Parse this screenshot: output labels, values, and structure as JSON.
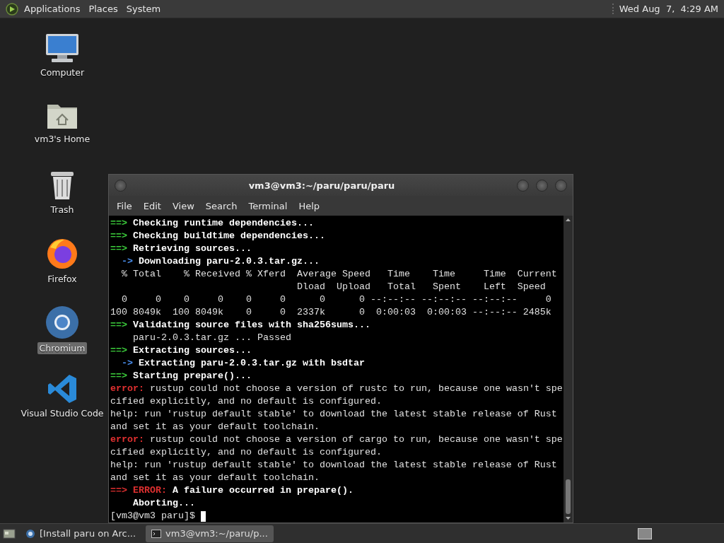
{
  "top_panel": {
    "menus": [
      "Applications",
      "Places",
      "System"
    ],
    "clock": "Wed Aug  7,  4:29 AM"
  },
  "desktop_icons": [
    {
      "kind": "computer",
      "label": "Computer",
      "selected": false
    },
    {
      "kind": "home",
      "label": "vm3's Home",
      "selected": false
    },
    {
      "kind": "trash",
      "label": "Trash",
      "selected": false
    },
    {
      "kind": "firefox",
      "label": "Firefox",
      "selected": false
    },
    {
      "kind": "chromium",
      "label": "Chromium",
      "selected": true
    },
    {
      "kind": "vscode",
      "label": "Visual Studio Code",
      "selected": false
    }
  ],
  "terminal": {
    "title": "vm3@vm3:~/paru/paru/paru",
    "menu": [
      "File",
      "Edit",
      "View",
      "Search",
      "Terminal",
      "Help"
    ],
    "lines": [
      [
        {
          "kind": "arrow",
          "text": "==> "
        },
        {
          "kind": "bold",
          "text": "Checking runtime dependencies..."
        }
      ],
      [
        {
          "kind": "arrow",
          "text": "==> "
        },
        {
          "kind": "bold",
          "text": "Checking buildtime dependencies..."
        }
      ],
      [
        {
          "kind": "arrow",
          "text": "==> "
        },
        {
          "kind": "bold",
          "text": "Retrieving sources..."
        }
      ],
      [
        {
          "kind": "subarrow",
          "text": "  -> "
        },
        {
          "kind": "bold",
          "text": "Downloading paru-2.0.3.tar.gz..."
        }
      ],
      [
        {
          "kind": "plain",
          "text": "  % Total    % Received % Xferd  Average Speed   Time    Time     Time  Current"
        }
      ],
      [
        {
          "kind": "plain",
          "text": "                                 Dload  Upload   Total   Spent    Left  Speed"
        }
      ],
      [
        {
          "kind": "plain",
          "text": "  0     0    0     0    0     0      0      0 --:--:-- --:--:-- --:--:--     0"
        }
      ],
      [
        {
          "kind": "plain",
          "text": "100 8049k  100 8049k    0     0  2337k      0  0:00:03  0:00:03 --:--:-- 2485k"
        }
      ],
      [
        {
          "kind": "arrow",
          "text": "==> "
        },
        {
          "kind": "bold",
          "text": "Validating source files with sha256sums..."
        }
      ],
      [
        {
          "kind": "plain",
          "text": "    paru-2.0.3.tar.gz ... Passed"
        }
      ],
      [
        {
          "kind": "arrow",
          "text": "==> "
        },
        {
          "kind": "bold",
          "text": "Extracting sources..."
        }
      ],
      [
        {
          "kind": "subarrow",
          "text": "  -> "
        },
        {
          "kind": "bold",
          "text": "Extracting paru-2.0.3.tar.gz with bsdtar"
        }
      ],
      [
        {
          "kind": "arrow",
          "text": "==> "
        },
        {
          "kind": "bold",
          "text": "Starting prepare()..."
        }
      ],
      [
        {
          "kind": "error",
          "text": "error:"
        },
        {
          "kind": "plain",
          "text": " rustup could not choose a version of rustc to run, because one wasn't spe"
        }
      ],
      [
        {
          "kind": "plain",
          "text": "cified explicitly, and no default is configured."
        }
      ],
      [
        {
          "kind": "plain",
          "text": "help: run 'rustup default stable' to download the latest stable release of Rust"
        }
      ],
      [
        {
          "kind": "plain",
          "text": "and set it as your default toolchain."
        }
      ],
      [
        {
          "kind": "error",
          "text": "error:"
        },
        {
          "kind": "plain",
          "text": " rustup could not choose a version of cargo to run, because one wasn't spe"
        }
      ],
      [
        {
          "kind": "plain",
          "text": "cified explicitly, and no default is configured."
        }
      ],
      [
        {
          "kind": "plain",
          "text": "help: run 'rustup default stable' to download the latest stable release of Rust"
        }
      ],
      [
        {
          "kind": "plain",
          "text": "and set it as your default toolchain."
        }
      ],
      [
        {
          "kind": "error",
          "text": "==> ERROR:"
        },
        {
          "kind": "bold",
          "text": " A failure occurred in prepare()."
        }
      ],
      [
        {
          "kind": "bold",
          "text": "    Aborting..."
        }
      ],
      [
        {
          "kind": "plain",
          "text": "[vm3@vm3 paru]$ "
        }
      ]
    ],
    "cursor": true
  },
  "taskbar": {
    "tasks": [
      {
        "kind": "browser",
        "label": "[Install paru on Arc...",
        "selected": false
      },
      {
        "kind": "terminal",
        "label": "vm3@vm3:~/paru/p...",
        "selected": true
      }
    ]
  }
}
